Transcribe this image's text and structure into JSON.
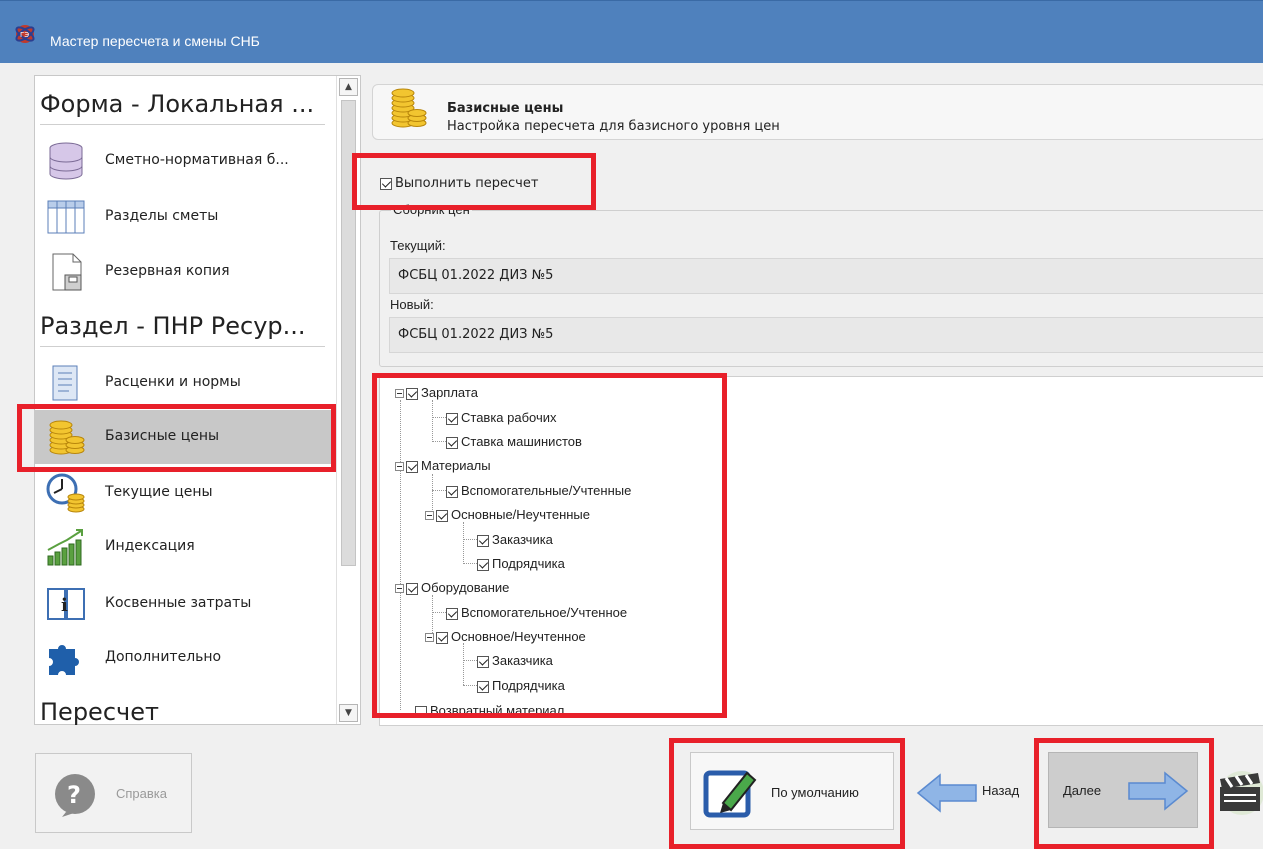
{
  "window": {
    "title": "Мастер пересчета и смены СНБ"
  },
  "sidebar": {
    "groups": [
      {
        "header": "Форма - Локальная ..."
      },
      {
        "header": "Раздел - ПНР Ресур..."
      },
      {
        "header": "Пересчет"
      }
    ],
    "items": [
      {
        "label": "Сметно-нормативная б...",
        "icon": "database-icon"
      },
      {
        "label": "Разделы сметы",
        "icon": "table-icon"
      },
      {
        "label": "Резервная копия",
        "icon": "backup-icon"
      },
      {
        "label": "Расценки и нормы",
        "icon": "book-icon"
      },
      {
        "label": "Базисные цены",
        "icon": "coins-icon",
        "selected": true
      },
      {
        "label": "Текущие цены",
        "icon": "clock-coins-icon"
      },
      {
        "label": "Индексация",
        "icon": "growth-chart-icon"
      },
      {
        "label": "Косвенные затраты",
        "icon": "info-book-icon"
      },
      {
        "label": "Дополнительно",
        "icon": "puzzle-icon"
      }
    ]
  },
  "header": {
    "title": "Базисные цены",
    "subtitle": "Настройка пересчета для базисного уровня цен"
  },
  "recalc_checkbox": {
    "label": "Выполнить пересчет",
    "checked": true
  },
  "price_collection": {
    "legend": "Сборник цен",
    "current_label": "Текущий:",
    "current_value": "ФСБЦ 01.2022 ДИЗ №5",
    "new_label": "Новый:",
    "new_value": "ФСБЦ 01.2022 ДИЗ №5"
  },
  "tree": {
    "nodes": [
      {
        "label": "Зарплата",
        "checked": true
      },
      {
        "label": "Ставка рабочих",
        "checked": true
      },
      {
        "label": "Ставка машинистов",
        "checked": true
      },
      {
        "label": "Материалы",
        "checked": true
      },
      {
        "label": "Вспомогательные/Учтенные",
        "checked": true
      },
      {
        "label": "Основные/Неучтенные",
        "checked": true
      },
      {
        "label": "Заказчика",
        "checked": true
      },
      {
        "label": "Подрядчика",
        "checked": true
      },
      {
        "label": "Оборудование",
        "checked": true
      },
      {
        "label": "Вспомогательное/Учтенное",
        "checked": true
      },
      {
        "label": "Основное/Неучтенное",
        "checked": true
      },
      {
        "label": "Заказчика",
        "checked": true
      },
      {
        "label": "Подрядчика",
        "checked": true
      },
      {
        "label": "Возвратный материал",
        "checked": false
      }
    ]
  },
  "buttons": {
    "help": "Справка",
    "default": "По умолчанию",
    "back": "Назад",
    "next": "Далее"
  },
  "colors": {
    "titlebar": "#4f81bd",
    "highlight": "#e8202a",
    "selected_item": "#c8c8c8",
    "arrow_blue": "#8fb5e6"
  }
}
